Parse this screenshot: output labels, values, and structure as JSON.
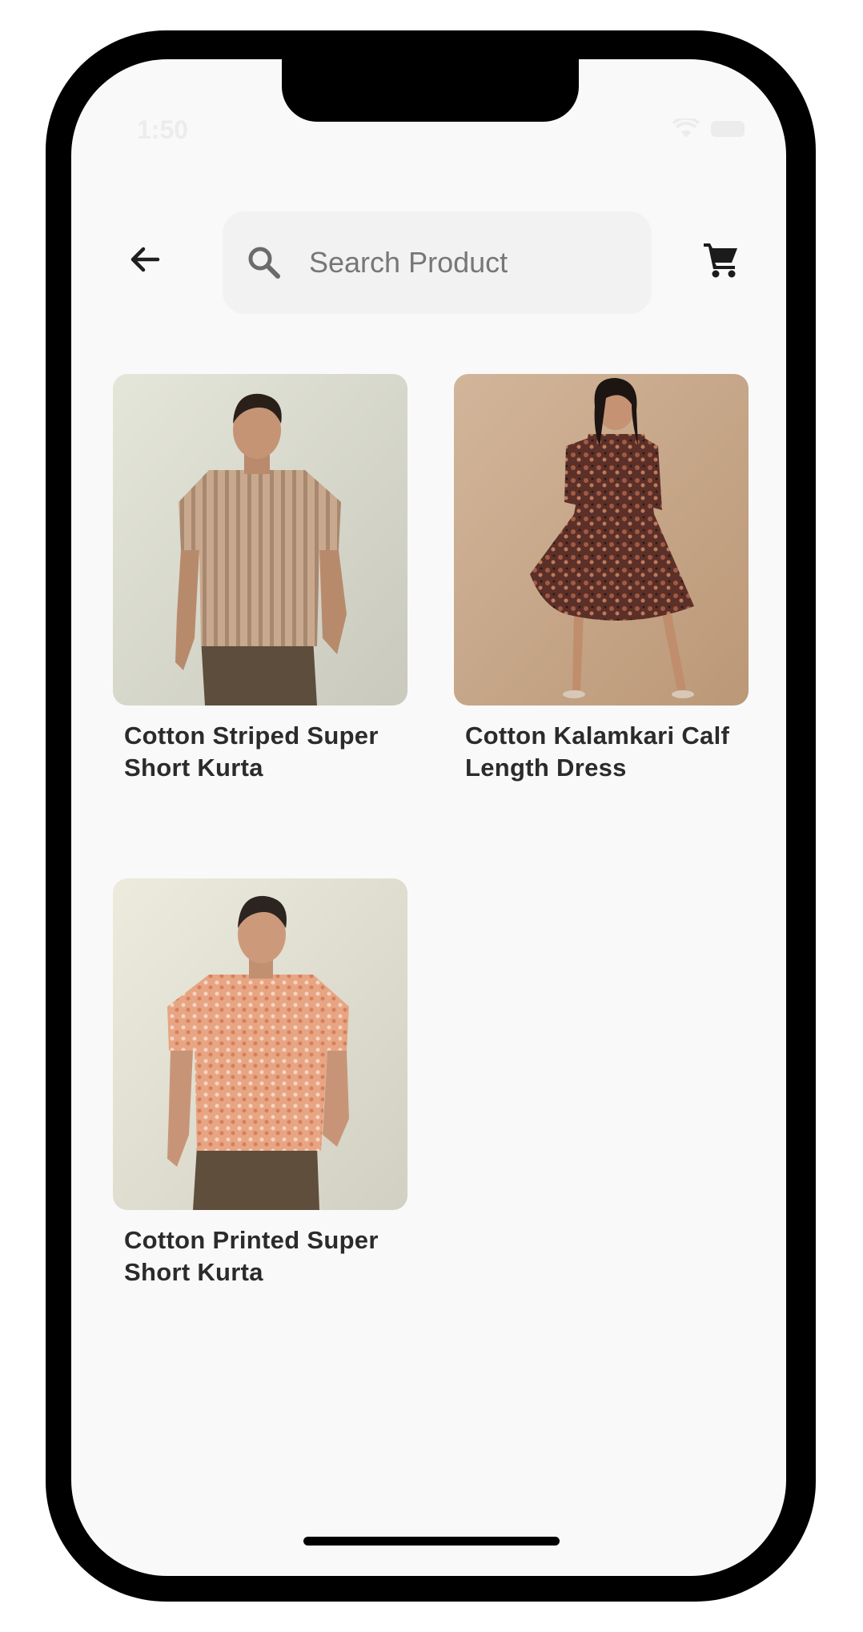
{
  "status_bar": {
    "time": "1:50"
  },
  "header": {
    "back_icon": "arrow-left-icon",
    "search": {
      "placeholder": "Search Product",
      "value": ""
    },
    "cart_icon": "shopping-cart-icon"
  },
  "products": [
    {
      "name": "Cotton Striped Super Short Kurta"
    },
    {
      "name": "Cotton Kalamkari Calf Length Dress"
    },
    {
      "name": "Cotton Printed Super Short Kurta"
    }
  ],
  "colors": {
    "background": "#f9f9f9",
    "search_bg": "#f2f2f2",
    "text": "#2b2b2b"
  }
}
